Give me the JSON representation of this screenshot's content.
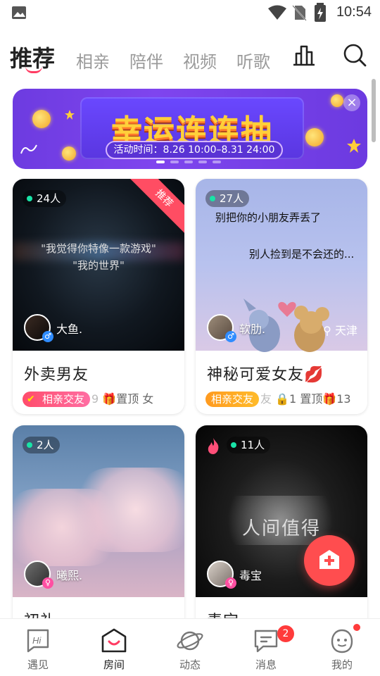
{
  "status_bar": {
    "time": "10:54"
  },
  "tabs": [
    {
      "label": "推荐",
      "active": true
    },
    {
      "label": "相亲",
      "active": false
    },
    {
      "label": "陪伴",
      "active": false
    },
    {
      "label": "视频",
      "active": false
    },
    {
      "label": "听歌",
      "active": false
    }
  ],
  "header": {
    "ranking_icon": "chart-icon",
    "search_icon": "search-icon"
  },
  "banner": {
    "title": "幸运连连抽",
    "date_text": "活动时间：8.26 10:00–8.31 24:00",
    "close_label": "×",
    "page_count": 5,
    "current_page": 1
  },
  "cards": [
    {
      "count": "24人",
      "corner_label": "推荐",
      "cover_text_line1": "\"我觉得你特像一款游戏\"",
      "cover_text_line2": "\"我的世界\"",
      "owner": "大鱼.",
      "gender": "male",
      "title": "外卖男友",
      "tag": "相亲交友",
      "tag_color": "pink",
      "faded": "9",
      "gift": "🎁置顶 女"
    },
    {
      "count": "27人",
      "cover_text_line1": "别把你的小朋友弄丢了",
      "cover_text_line2": "别人捡到是不会还的...",
      "owner": "软肋.",
      "gender": "male",
      "location": "天津",
      "title": "神秘可爱女友💋",
      "tag": "相亲交友",
      "tag_color": "orange",
      "faded": "友",
      "gift": "🔒1 置顶🎁13"
    },
    {
      "count": "2人",
      "owner": "曦熙.",
      "gender": "female",
      "title": "初礼"
    },
    {
      "count": "11人",
      "cover_text_line1": "人间值得",
      "owner": "毒宝",
      "gender": "female",
      "title": "毒宝"
    }
  ],
  "bottom_nav": [
    {
      "label": "遇见",
      "icon": "hi-icon"
    },
    {
      "label": "房间",
      "icon": "room-icon",
      "active": true
    },
    {
      "label": "动态",
      "icon": "planet-icon"
    },
    {
      "label": "消息",
      "icon": "message-icon",
      "badge": "2"
    },
    {
      "label": "我的",
      "icon": "profile-icon"
    }
  ],
  "colors": {
    "accent": "#ff3b62",
    "fab": "#ff4d4f",
    "online": "#19e3a7",
    "banner": "#7f45ee"
  }
}
